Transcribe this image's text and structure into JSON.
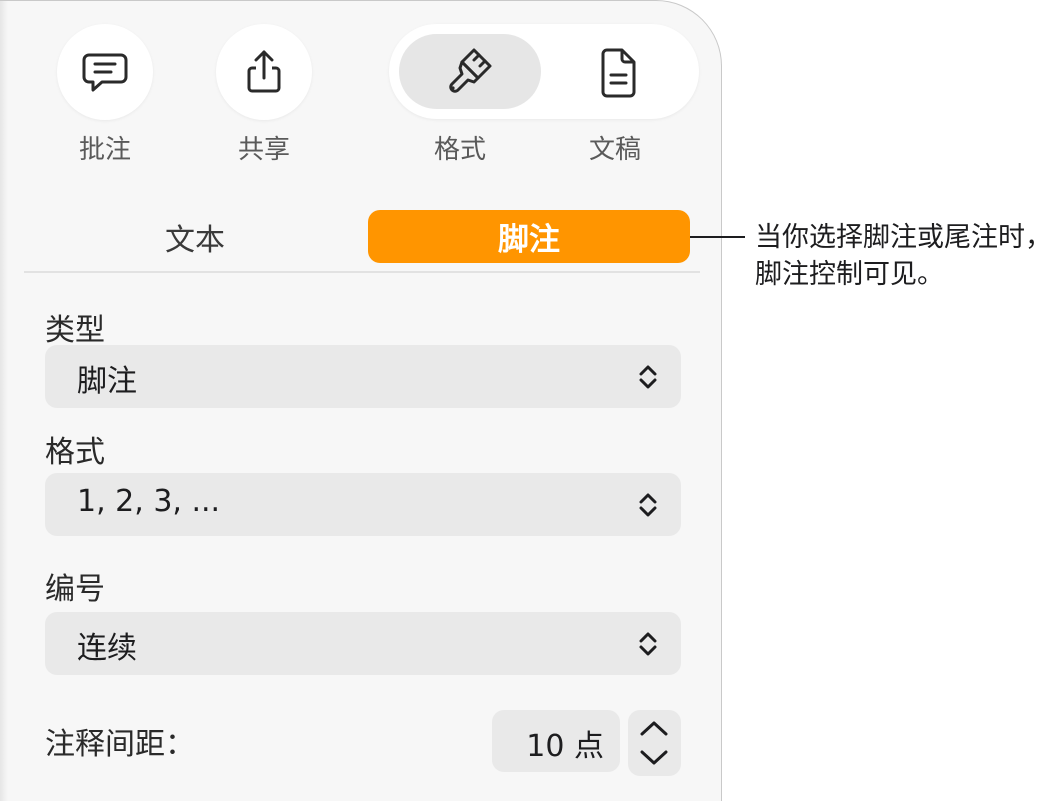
{
  "toolbar": {
    "comment_label": "批注",
    "share_label": "共享",
    "format_label": "格式",
    "document_label": "文稿"
  },
  "tabs": {
    "text_label": "文本",
    "footnote_label": "脚注",
    "active": "脚注"
  },
  "sections": {
    "type": {
      "label": "类型",
      "value": "脚注"
    },
    "format": {
      "label": "格式",
      "value": "1, 2, 3, ..."
    },
    "numbering": {
      "label": "编号",
      "value": "连续"
    },
    "spacing": {
      "label": "注释间距：",
      "value": "10 点"
    }
  },
  "callout": {
    "line1": "当你选择脚注或尾注时，",
    "line2": "脚注控制可见。"
  },
  "colors": {
    "accent": "#ff9500",
    "panel_bg": "#f7f7f7",
    "control_bg": "#e9e9e9",
    "selected_segment": "#e6e6e6"
  },
  "icons": {
    "comment": "speech-bubble-icon",
    "share": "share-icon",
    "format": "paintbrush-icon",
    "document": "document-icon",
    "chevron": "up-down-chevron-icon"
  }
}
